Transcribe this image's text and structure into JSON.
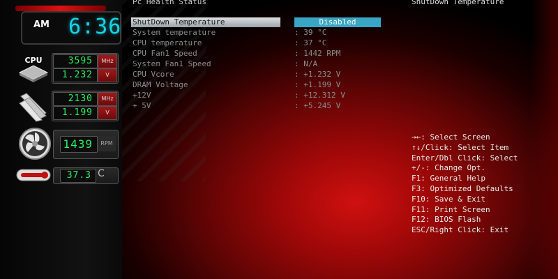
{
  "header": {
    "section_title": "Pc Health Status",
    "help_title": "ShutDown Temperature"
  },
  "clock": {
    "ampm": "AM",
    "time": "6:36"
  },
  "monitors": {
    "cpu_label": "CPU",
    "cpu_freq": "3595",
    "cpu_freq_unit": "MHz",
    "cpu_volt": "1.232",
    "cpu_volt_unit": "V",
    "mem_freq": "2130",
    "mem_freq_unit": "MHz",
    "mem_volt": "1.199",
    "mem_volt_unit": "V",
    "fan_rpm": "1439",
    "fan_unit": "RPM",
    "temp": "37.3",
    "temp_unit": "C"
  },
  "settings": [
    {
      "label": "ShutDown Temperature",
      "value": "Disabled"
    },
    {
      "label": "System temperature",
      "value": ": 39 °C"
    },
    {
      "label": "CPU temperature",
      "value": ": 37 °C"
    },
    {
      "label": "CPU Fan1 Speed",
      "value": ": 1442 RPM"
    },
    {
      "label": "System Fan1 Speed",
      "value": ": N/A"
    },
    {
      "label": "CPU Vcore",
      "value": ": +1.232 V"
    },
    {
      "label": "DRAM Voltage",
      "value": ": +1.199 V"
    },
    {
      "label": "+12V",
      "value": ": +12.312 V"
    },
    {
      "label": "+ 5V",
      "value": ": +5.245 V"
    }
  ],
  "help": [
    "→←: Select Screen",
    "↑↓/Click: Select Item",
    "Enter/Dbl Click: Select",
    "+/-: Change Opt.",
    "F1: General Help",
    "F3: Optimized Defaults",
    "F10: Save & Exit",
    "F11: Print Screen",
    "F12: BIOS Flash",
    "ESC/Right Click: Exit"
  ],
  "colors": {
    "accent_red": "#d01010",
    "lcd_green": "#27f05a",
    "clock_cyan": "#19d3e6",
    "selected_value_bg": "#3aa6c6"
  }
}
